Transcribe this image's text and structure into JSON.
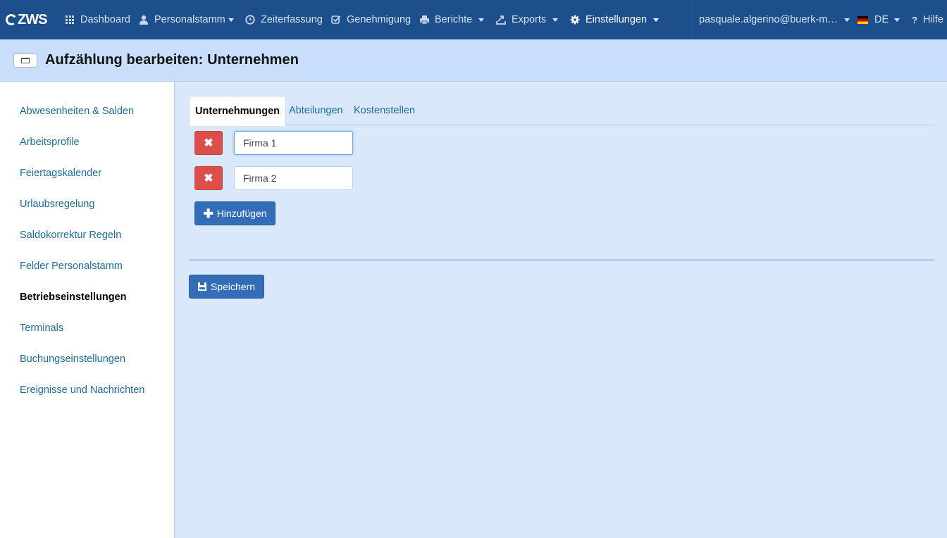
{
  "nav": {
    "logo": "ZWS",
    "items": [
      {
        "label": "Dashboard",
        "icon": "grid-icon",
        "caret": false
      },
      {
        "label": "Personalstamm",
        "icon": "user-icon",
        "caret": true
      },
      {
        "label": "Zeiterfassung",
        "icon": "clock-icon",
        "caret": false
      },
      {
        "label": "Genehmigung",
        "icon": "check-icon",
        "caret": false
      },
      {
        "label": "Berichte",
        "icon": "print-icon",
        "caret": true
      },
      {
        "label": "Exports",
        "icon": "export-icon",
        "caret": true
      },
      {
        "label": "Einstellungen",
        "icon": "gear-icon",
        "caret": true,
        "active": true
      }
    ],
    "user": "pasquale.algerino@buerk-m…",
    "language": "DE",
    "help": "Hilfe"
  },
  "header": {
    "title": "Aufzählung bearbeiten: Unternehmen"
  },
  "sidebar": {
    "items": [
      {
        "label": "Abwesenheiten & Salden"
      },
      {
        "label": "Arbeitsprofile"
      },
      {
        "label": "Feiertagskalender"
      },
      {
        "label": "Urlaubsregelung"
      },
      {
        "label": "Saldokorrektur Regeln"
      },
      {
        "label": "Felder Personalstamm"
      },
      {
        "label": "Betriebseinstellungen",
        "current": true
      },
      {
        "label": "Terminals"
      },
      {
        "label": "Buchungseinstellungen"
      },
      {
        "label": "Ereignisse und Nachrichten"
      }
    ]
  },
  "tabs": [
    {
      "label": "Unternehmungen",
      "active": true
    },
    {
      "label": "Abteilungen"
    },
    {
      "label": "Kostenstellen"
    }
  ],
  "entries": [
    {
      "value": "Firma 1",
      "focused": true
    },
    {
      "value": "Firma 2"
    }
  ],
  "buttons": {
    "add": "Hinzufügen",
    "save": "Speichern"
  },
  "colors": {
    "navbar": "#1d4f8c",
    "header": "#c9defb",
    "content": "#dae8fc",
    "primary": "#336db8",
    "danger": "#dc4e4b",
    "link": "#1e6b99"
  }
}
